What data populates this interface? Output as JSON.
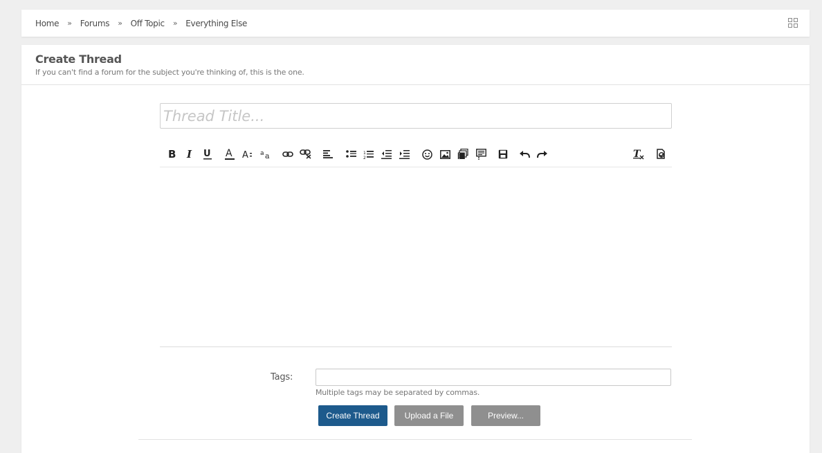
{
  "breadcrumb": {
    "items": [
      "Home",
      "Forums",
      "Off Topic",
      "Everything Else"
    ],
    "separator": "»"
  },
  "header": {
    "title": "Create Thread",
    "subtitle": "If you can't find a forum for the subject you're thinking of, this is the one."
  },
  "form": {
    "title_placeholder": "Thread Title...",
    "title_value": "",
    "tags_label": "Tags:",
    "tags_value": "",
    "tags_hint": "Multiple tags may be separated by commas."
  },
  "toolbar": {
    "tools": [
      "bold",
      "italic",
      "underline",
      "font-color",
      "font-size",
      "font-family",
      "link",
      "unlink",
      "align",
      "bullet-list",
      "numbered-list",
      "outdent",
      "indent",
      "smilies",
      "image",
      "media",
      "quote",
      "code",
      "save",
      "undo",
      "redo",
      "remove-format",
      "bbcode-toggle"
    ]
  },
  "buttons": {
    "create": "Create Thread",
    "upload": "Upload a File",
    "preview": "Preview..."
  },
  "colors": {
    "primary": "#1d5a8c",
    "secondary": "#8f8f8f",
    "background": "#efefef"
  }
}
